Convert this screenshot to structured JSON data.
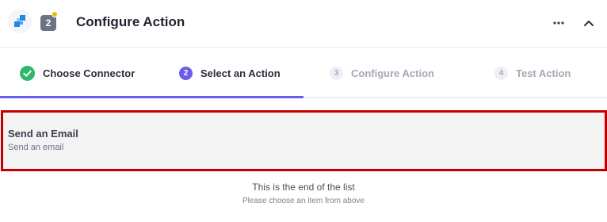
{
  "header": {
    "step_number": "2",
    "title": "Configure Action"
  },
  "tabs": [
    {
      "number": "",
      "label": "Choose Connector",
      "state": "done"
    },
    {
      "number": "2",
      "label": "Select an Action",
      "state": "active"
    },
    {
      "number": "3",
      "label": "Configure Action",
      "state": "pending"
    },
    {
      "number": "4",
      "label": "Test Action",
      "state": "pending"
    }
  ],
  "actions": [
    {
      "title": "Send an Email",
      "subtitle": "Send an email"
    }
  ],
  "list_footer": {
    "title": "This is the end of the list",
    "subtitle": "Please choose an item from above"
  },
  "colors": {
    "accent": "#6c5ce7",
    "success": "#2fb86a",
    "selection_border": "#c00000",
    "notification": "#f4b400"
  },
  "icons": {
    "logo": "app-logo-icon",
    "more": "more-dots-icon",
    "collapse": "chevron-up-icon",
    "done": "check-circle-icon"
  }
}
